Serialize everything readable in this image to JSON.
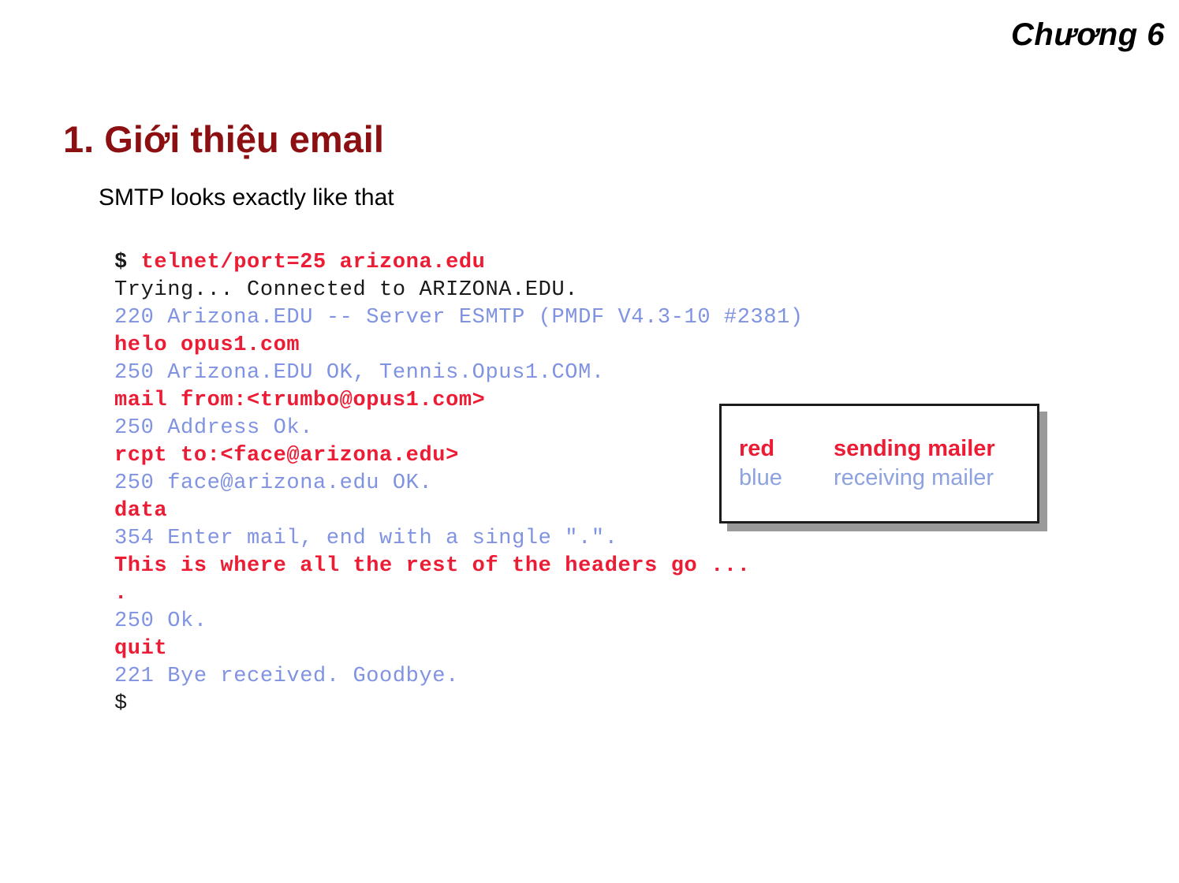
{
  "header": {
    "chapter": "Chương 6"
  },
  "slide": {
    "title": "1. Giới thiệu email",
    "subtitle": "SMTP looks exactly like that"
  },
  "transcript": {
    "prompt_symbol": "$",
    "lines": [
      {
        "role": "prompt",
        "prompt": "$ ",
        "command": "telnet/port=25 arizona.edu",
        "text": "$ telnet/port=25 arizona.edu"
      },
      {
        "role": "local",
        "text": "Trying... Connected to ARIZONA.EDU."
      },
      {
        "role": "server",
        "text": "220 Arizona.EDU -- Server ESMTP (PMDF V4.3-10 #2381)"
      },
      {
        "role": "client",
        "text": "helo opus1.com"
      },
      {
        "role": "server",
        "text": "250 Arizona.EDU OK, Tennis.Opus1.COM."
      },
      {
        "role": "client",
        "text": "mail from:<trumbo@opus1.com>"
      },
      {
        "role": "server",
        "text": "250 Address Ok."
      },
      {
        "role": "client",
        "text": "rcpt to:<face@arizona.edu>"
      },
      {
        "role": "server",
        "text": "250 face@arizona.edu OK."
      },
      {
        "role": "client",
        "text": "data"
      },
      {
        "role": "server",
        "text": "354 Enter mail, end with a single \".\"."
      },
      {
        "role": "client",
        "text": "This is where all the rest of the headers go ..."
      },
      {
        "role": "client",
        "text": "."
      },
      {
        "role": "server",
        "text": "250 Ok."
      },
      {
        "role": "client",
        "text": "quit"
      },
      {
        "role": "server",
        "text": "221 Bye received. Goodbye."
      },
      {
        "role": "local",
        "text": "$"
      }
    ]
  },
  "legend": {
    "rows": [
      {
        "key": "red",
        "value": "sending mailer"
      },
      {
        "key": "blue",
        "value": "receiving mailer"
      }
    ]
  },
  "colors": {
    "title_red": "#8C0F12",
    "client_red": "#ED1C35",
    "server_blue": "#8093E2",
    "legend_blue": "#8DA2E0",
    "text_black": "#1A1A1A",
    "shadow_grey": "#9A9A9A",
    "background": "#FFFFFF"
  }
}
